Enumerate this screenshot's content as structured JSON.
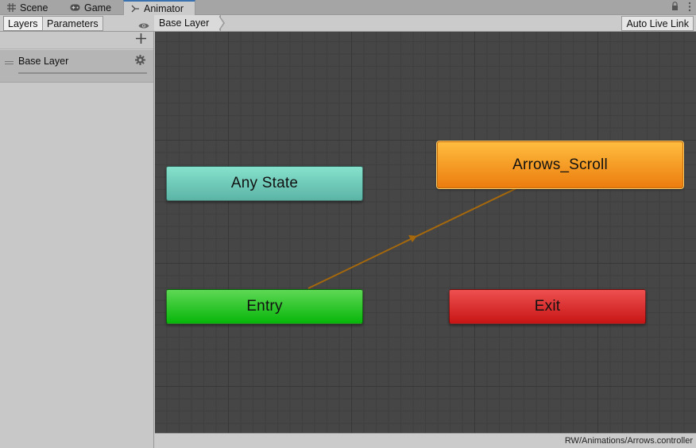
{
  "window_tabs": [
    {
      "label": "Scene",
      "icon": "grid-icon",
      "active": false
    },
    {
      "label": "Game",
      "icon": "gamepad-icon",
      "active": false
    },
    {
      "label": "Animator",
      "icon": "animator-icon",
      "active": true
    }
  ],
  "toolbar": {
    "layers_label": "Layers",
    "parameters_label": "Parameters",
    "breadcrumb": "Base Layer",
    "auto_live_link_label": "Auto Live Link"
  },
  "layers_panel": {
    "add_icon": "plus-icon",
    "visibility_icon": "eye-icon",
    "layers": [
      {
        "name": "Base Layer",
        "settings_icon": "gear-icon"
      }
    ]
  },
  "graph": {
    "states": [
      {
        "name": "Any State",
        "kind": "any-state",
        "color": "#6fcab9"
      },
      {
        "name": "Arrows_Scroll",
        "kind": "default-state",
        "color": "#f39a22"
      },
      {
        "name": "Entry",
        "kind": "entry",
        "color": "#28c72b"
      },
      {
        "name": "Exit",
        "kind": "exit",
        "color": "#de2f2f"
      }
    ],
    "transitions": [
      {
        "from": "Entry",
        "to": "Arrows_Scroll",
        "color": "#a5680c"
      }
    ]
  },
  "status": {
    "controller_path": "RW/Animations/Arrows.controller"
  },
  "colors": {
    "accent": "#3a72b0",
    "graph_background": "#464646"
  }
}
